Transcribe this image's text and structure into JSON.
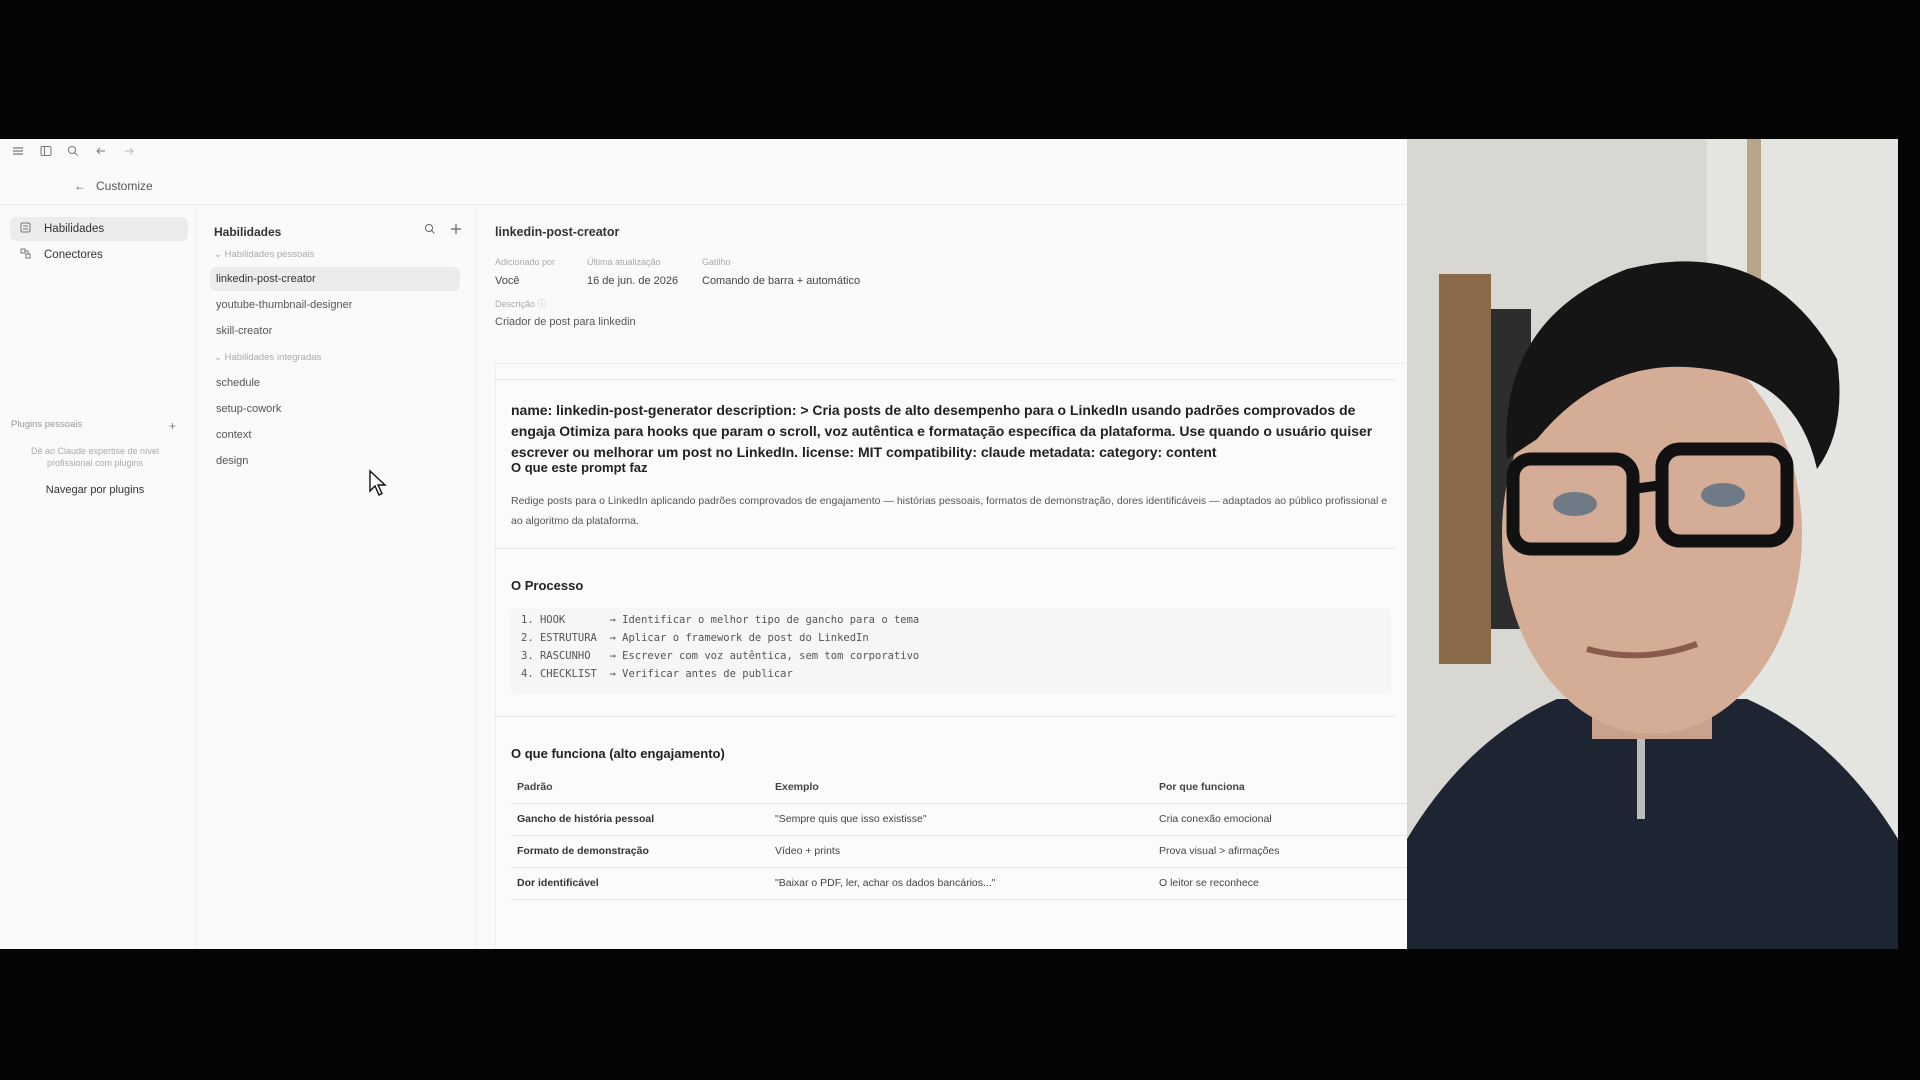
{
  "topbar": {
    "icons": [
      "menu-icon",
      "sidebar-icon",
      "search-icon",
      "back-arrow-icon",
      "forward-arrow-icon"
    ]
  },
  "breadcrumb": {
    "back_glyph": "←",
    "label": "Customize"
  },
  "rail": {
    "items": [
      {
        "label": "Habilidades",
        "icon": "skills-icon",
        "active": true
      },
      {
        "label": "Conectores",
        "icon": "connectors-icon",
        "active": false
      }
    ],
    "section_label": "Plugins pessoais",
    "section_add": "+",
    "description": "Dê ao Claude expertise de nível profissional com plugins",
    "browse_link": "Navegar por plugins"
  },
  "skills": {
    "title": "Habilidades",
    "personal_label": "Habilidades pessoais",
    "personal": [
      "linkedin-post-creator",
      "youtube-thumbnail-designer",
      "skill-creator"
    ],
    "builtin_label": "Habilidades integradas",
    "builtin": [
      "schedule",
      "setup-cowork",
      "context",
      "design"
    ]
  },
  "detail": {
    "title": "linkedin-post-creator",
    "meta": [
      {
        "label": "Adicionado por",
        "value": "Você"
      },
      {
        "label": "Última atualização",
        "value": "16 de jun. de 2026"
      },
      {
        "label": "Gatilho",
        "value": "Comando de barra + automático"
      }
    ],
    "description_label": "Descrição",
    "description": "Criador de post para linkedin",
    "frontmatter": "name: linkedin-post-generator description: > Cria posts de alto desempenho para o LinkedIn usando padrões comprovados de engaja Otimiza para hooks que param o scroll, voz autêntica e formatação específica da plataforma. Use quando o usuário quiser escrever ou melhorar um post no LinkedIn. license: MIT compatibility: claude metadata: category: content",
    "section1_title": "O que este prompt faz",
    "section1_text": "Redige posts para o LinkedIn aplicando padrões comprovados de engajamento — histórias pessoais, formatos de demonstração, dores identificáveis — adaptados ao público profissional e ao algoritmo da plataforma.",
    "section2_title": "O Processo",
    "process": [
      "1. HOOK       → Identificar o melhor tipo de gancho para o tema",
      "2. ESTRUTURA  → Aplicar o framework de post do LinkedIn",
      "3. RASCUNHO   → Escrever com voz autêntica, sem tom corporativo",
      "4. CHECKLIST  → Verificar antes de publicar"
    ],
    "section3_title": "O que funciona (alto engajamento)",
    "table": {
      "headers": [
        "Padrão",
        "Exemplo",
        "Por que funciona"
      ],
      "rows": [
        [
          "Gancho de história pessoal",
          "\"Sempre quis que isso existisse\"",
          "Cria conexão emocional"
        ],
        [
          "Formato de demonstração",
          "Vídeo + prints",
          "Prova visual > afirmações"
        ],
        [
          "Dor identificável",
          "\"Baixar o PDF, ler, achar os dados bancários...\"",
          "O leitor se reconhece"
        ]
      ]
    }
  },
  "colors": {
    "app_bg": "#fafafa",
    "frame_bg": "#050505",
    "active_bg": "#ececec"
  }
}
